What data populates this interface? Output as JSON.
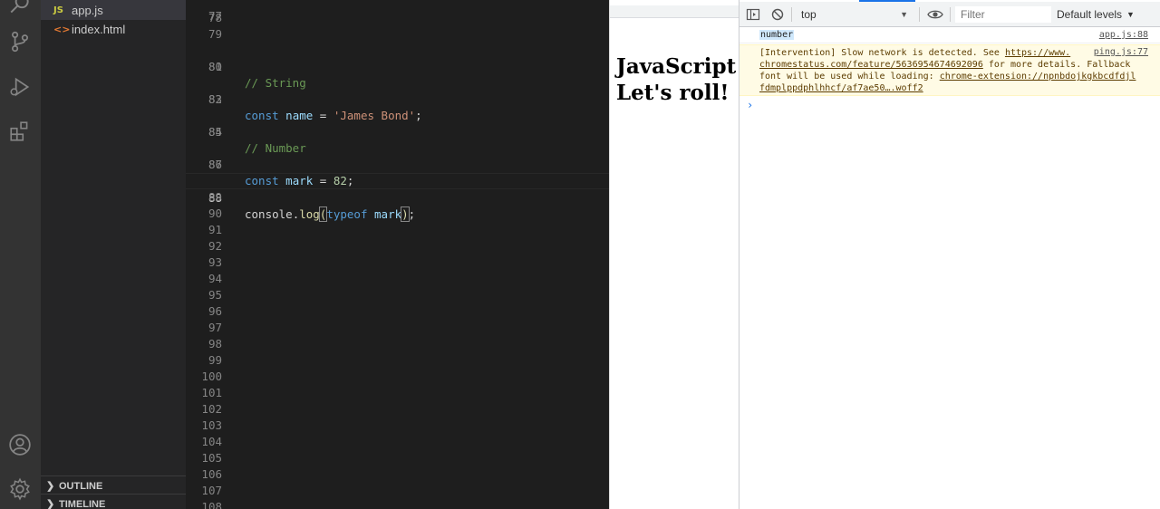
{
  "activity_bar": {
    "icons": [
      "search-icon",
      "source-control-icon",
      "run-debug-icon",
      "extensions-icon",
      "account-icon",
      "settings-gear-icon"
    ]
  },
  "explorer": {
    "files": [
      {
        "name": "app.js",
        "icon": "JS",
        "active": true
      },
      {
        "name": "index.html",
        "icon": "<>",
        "active": false
      }
    ],
    "sections": [
      "OUTLINE",
      "TIMELINE"
    ]
  },
  "editor": {
    "partial_top_line": "77",
    "lines": [
      {
        "n": "78"
      },
      {
        "n": "79"
      },
      {
        "n": "80",
        "comment": "// String"
      },
      {
        "n": "81"
      },
      {
        "n": "82",
        "kw": "const",
        "var": "name",
        "op": " = ",
        "str": "'James Bond'",
        "end": ";"
      },
      {
        "n": "83"
      },
      {
        "n": "84",
        "comment": "// Number"
      },
      {
        "n": "85"
      },
      {
        "n": "86",
        "kw": "const",
        "var": "mark",
        "op": " = ",
        "num": "82",
        "end": ";"
      },
      {
        "n": "87"
      },
      {
        "n": "88",
        "obj": "console",
        "dot": ".",
        "fn": "log",
        "open": "(",
        "kw2": "typeof",
        "sp": " ",
        "var2": "mark",
        "close": ")",
        "end": ";"
      },
      {
        "n": "89"
      },
      {
        "n": "90"
      },
      {
        "n": "91"
      },
      {
        "n": "92"
      },
      {
        "n": "93"
      },
      {
        "n": "94"
      },
      {
        "n": "95"
      },
      {
        "n": "96"
      },
      {
        "n": "97"
      },
      {
        "n": "98"
      },
      {
        "n": "99"
      },
      {
        "n": "100"
      },
      {
        "n": "101"
      },
      {
        "n": "102"
      },
      {
        "n": "103"
      },
      {
        "n": "104"
      },
      {
        "n": "105"
      },
      {
        "n": "106"
      },
      {
        "n": "107"
      },
      {
        "n": "108"
      }
    ]
  },
  "browser_page": {
    "heading_line1": "JavaScript f",
    "heading_line2": "Let's roll!"
  },
  "devtools": {
    "context": "top",
    "filter_placeholder": "Filter",
    "levels_label": "Default levels",
    "log": {
      "text": "number",
      "source": "app.js:88"
    },
    "warning": {
      "line1_text": "[Intervention] Slow network is detected. See ",
      "line1_link": "https://www.",
      "line2_link": "chromestatus.com/feature/5636954674692096",
      "line2_text": " for more details. Fallback",
      "line3_text": "font will be used while loading: ",
      "line3_link": "chrome-extension://npnbdojkgkbcdfdjl",
      "line4_link": "fdmplppdphlhhcf/af7ae50….woff2",
      "source": "ping.js:77"
    },
    "prompt_glyph": "›"
  }
}
